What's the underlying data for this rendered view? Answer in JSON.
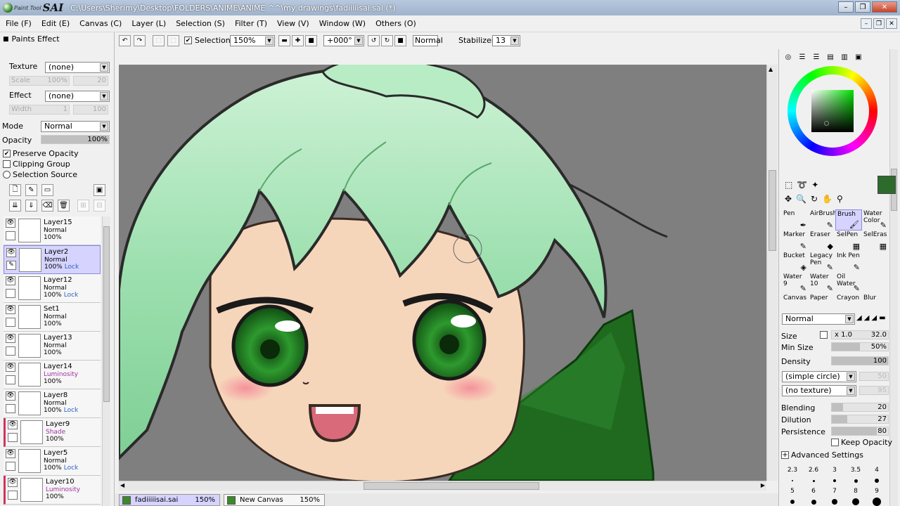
{
  "window": {
    "logo_small": "Paint Tool",
    "logo_big": "SAI",
    "title": "C:\\Users\\Sherimy\\Desktop\\FOLDERS\\ANIME\\ANIME ^^\\my drawings\\fadiiiiisai.sai (*)"
  },
  "menu": [
    "File (F)",
    "Edit (E)",
    "Canvas (C)",
    "Layer (L)",
    "Selection (S)",
    "Filter (T)",
    "View (V)",
    "Window (W)",
    "Others (O)"
  ],
  "left": {
    "paints_effect": "Paints Effect",
    "texture_label": "Texture",
    "texture_value": "(none)",
    "scale_label": "Scale",
    "scale_value": "100%",
    "scale_num": "20",
    "effect_label": "Effect",
    "effect_value": "(none)",
    "width_label": "Width",
    "width_value": "1",
    "width_num": "100",
    "mode_label": "Mode",
    "mode_value": "Normal",
    "opacity_label": "Opacity",
    "opacity_value": "100%",
    "opacity_level": 1.0,
    "preserve_opacity": "Preserve Opacity",
    "clipping_group": "Clipping Group",
    "selection_source": "Selection Source"
  },
  "layers": [
    {
      "name": "Layer15",
      "mode": "Normal",
      "opacity": "100%",
      "lock": "",
      "active": false,
      "mode_color": "normal"
    },
    {
      "name": "Layer2",
      "mode": "Normal",
      "opacity": "100%",
      "lock": "Lock",
      "active": true,
      "mode_color": "normal"
    },
    {
      "name": "Layer12",
      "mode": "Normal",
      "opacity": "100%",
      "lock": "Lock",
      "active": false,
      "mode_color": "normal"
    },
    {
      "name": "Set1",
      "mode": "Normal",
      "opacity": "100%",
      "lock": "",
      "active": false,
      "mode_color": "normal"
    },
    {
      "name": "Layer13",
      "mode": "Normal",
      "opacity": "100%",
      "lock": "",
      "active": false,
      "mode_color": "normal"
    },
    {
      "name": "Layer14",
      "mode": "Luminosity",
      "opacity": "100%",
      "lock": "",
      "active": false,
      "mode_color": "lum"
    },
    {
      "name": "Layer8",
      "mode": "Normal",
      "opacity": "100%",
      "lock": "Lock",
      "active": false,
      "mode_color": "normal"
    },
    {
      "name": "Layer9",
      "mode": "Shade",
      "opacity": "100%",
      "lock": "",
      "active": false,
      "mode_color": "lum"
    },
    {
      "name": "Layer5",
      "mode": "Normal",
      "opacity": "100%",
      "lock": "Lock",
      "active": false,
      "mode_color": "normal"
    },
    {
      "name": "Layer10",
      "mode": "Luminosity",
      "opacity": "100%",
      "lock": "",
      "active": false,
      "mode_color": "lum"
    }
  ],
  "toolbar": {
    "selection_label": "Selection",
    "zoom": "150%",
    "rotation": "+000°",
    "blend_mode": "Normal",
    "stabilizer_label": "Stabilizer",
    "stabilizer_value": "13"
  },
  "tabs": [
    {
      "name": "fadiiiiisai.sai",
      "zoom": "150%"
    },
    {
      "name": "New Canvas",
      "zoom": "150%"
    }
  ],
  "right": {
    "brushes": [
      {
        "name": "Pen",
        "glyph": "✒"
      },
      {
        "name": "AirBrush",
        "glyph": "✎"
      },
      {
        "name": "Brush",
        "glyph": "🖌"
      },
      {
        "name": "Water Color",
        "glyph": "✎"
      },
      {
        "name": "Marker",
        "glyph": "✎"
      },
      {
        "name": "Eraser",
        "glyph": "◆"
      },
      {
        "name": "SelPen",
        "glyph": "▦"
      },
      {
        "name": "SelEras",
        "glyph": "▦"
      },
      {
        "name": "Bucket",
        "glyph": "◈"
      },
      {
        "name": "Legacy Pen",
        "glyph": "✎"
      },
      {
        "name": "Ink Pen",
        "glyph": "✎"
      },
      {
        "name": "",
        "glyph": ""
      },
      {
        "name": "Water 9",
        "glyph": "✎"
      },
      {
        "name": "Water 10",
        "glyph": "✎"
      },
      {
        "name": "Oil Water",
        "glyph": "✎"
      },
      {
        "name": "",
        "glyph": ""
      },
      {
        "name": "Canvas",
        "glyph": ""
      },
      {
        "name": "Paper",
        "glyph": ""
      },
      {
        "name": "Crayon",
        "glyph": ""
      },
      {
        "name": "Blur",
        "glyph": ""
      }
    ],
    "mode_value": "Normal",
    "size_label": "Size",
    "size_mult": "x 1.0",
    "size_value": "32.0",
    "minsize_label": "Min Size",
    "minsize_value": "50%",
    "minsize_level": 0.5,
    "density_label": "Density",
    "density_value": "100",
    "density_level": 1.0,
    "shape_value": "(simple circle)",
    "shape_num": "50",
    "texture_value": "(no texture)",
    "texture_num": "95",
    "blending_label": "Blending",
    "blending_value": "20",
    "blending_level": 0.2,
    "dilution_label": "Dilution",
    "dilution_value": "27",
    "dilution_level": 0.27,
    "persistence_label": "Persistence",
    "persistence_value": "80",
    "persistence_level": 0.8,
    "keep_opacity": "Keep Opacity",
    "advanced": "Advanced Settings",
    "sizes_row1": [
      "2.3",
      "2.6",
      "3",
      "3.5",
      "4"
    ],
    "sizes_row2": [
      "5",
      "6",
      "7",
      "8",
      "9"
    ]
  },
  "colors": {
    "current": "#2d6b2d",
    "hair": "#9ee0b0",
    "eyes": "#2e8a2e",
    "cloak": "#1f6a1f",
    "skin": "#f6d6bb",
    "canvas_bg": "#7f7f7f"
  }
}
